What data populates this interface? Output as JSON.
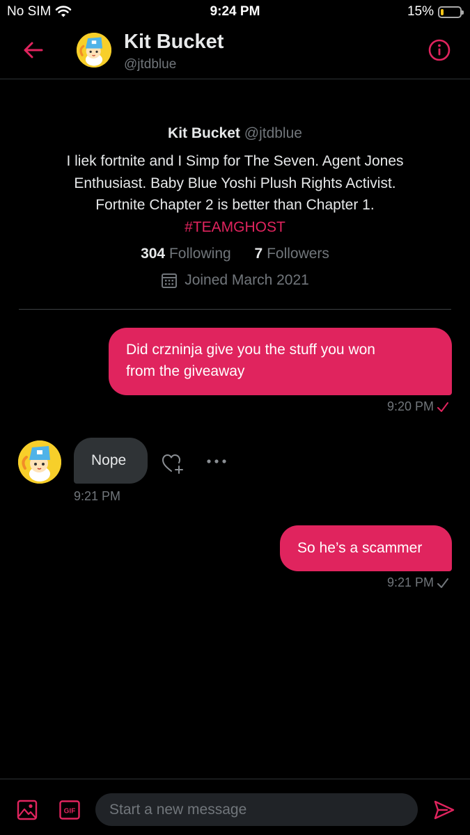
{
  "status_bar": {
    "carrier": "No SIM",
    "time": "9:24 PM",
    "battery": "15%",
    "battery_level": 0.15
  },
  "header": {
    "name": "Kit Bucket",
    "handle": "@jtdblue",
    "back_icon": "back-arrow-icon",
    "info_icon": "info-icon"
  },
  "profile": {
    "name": "Kit Bucket",
    "handle": "@jtdblue",
    "bio_lines": [
      "I liek fortnite and I Simp for The Seven. Agent Jones",
      "Enthusiast. Baby Blue Yoshi Plush Rights Activist.",
      "Fortnite Chapter 2 is better than Chapter 1."
    ],
    "hashtag": "#TEAMGHOST",
    "following_count": "304",
    "following_label": "Following",
    "followers_count": "7",
    "followers_label": "Followers",
    "joined": "Joined March 2021"
  },
  "messages": [
    {
      "direction": "outgoing",
      "lines": [
        "Did crzninja give you the stuff you won",
        "from the giveaway"
      ],
      "time": "9:20 PM",
      "status": "sent"
    },
    {
      "direction": "incoming",
      "lines": [
        "Nope"
      ],
      "time": "9:21 PM"
    },
    {
      "direction": "outgoing",
      "lines": [
        "So he’s a scammer"
      ],
      "time": "9:21 PM",
      "status": "sent"
    }
  ],
  "composer": {
    "placeholder": "Start a new message",
    "gif_label": "GIF"
  },
  "colors": {
    "accent": "#e0245e",
    "background": "#000000",
    "incoming_bubble": "#2f3336",
    "muted_text": "#71767b"
  }
}
